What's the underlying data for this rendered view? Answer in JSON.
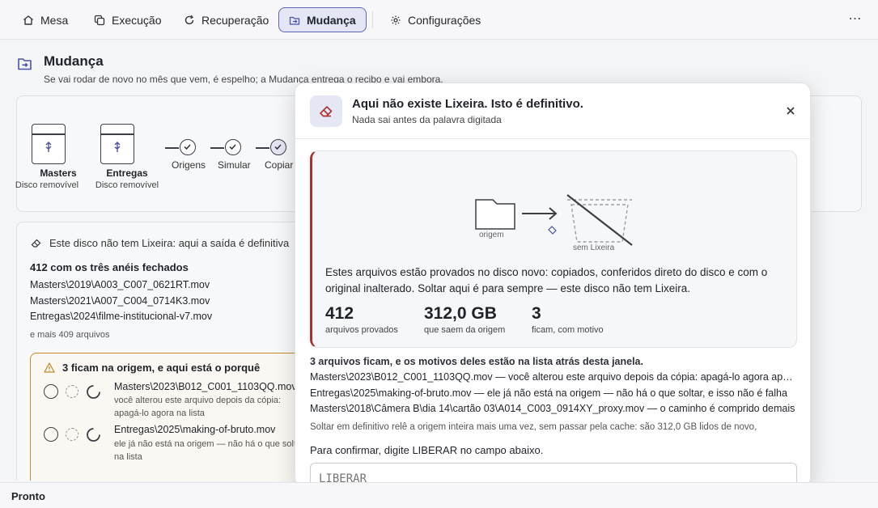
{
  "nav": {
    "tabs": [
      {
        "label": "Mesa",
        "icon": "home-icon"
      },
      {
        "label": "Execução",
        "icon": "copy-icon"
      },
      {
        "label": "Recuperação",
        "icon": "refresh-icon"
      },
      {
        "label": "Mudança",
        "icon": "move-icon",
        "active": true
      },
      {
        "label": "Configurações",
        "icon": "gear-icon"
      }
    ],
    "more_label": "⋯"
  },
  "page": {
    "title": "Mudança",
    "subtitle": "Se vai rodar de novo no mês que vem, é espelho; a Mudança entrega o recibo e vai embora."
  },
  "disks": [
    {
      "name": "Masters",
      "sub": "Disco removível"
    },
    {
      "name": "Entregas",
      "sub": "Disco removível"
    }
  ],
  "steps": [
    "Origens",
    "Simular",
    "Copiar"
  ],
  "trash_card": {
    "header": "Este disco não tem Lixeira: aqui a saída é definitiva",
    "title": "412 com os três anéis fechados",
    "files": [
      "Masters\\2019\\A003_C007_0621RT.mov",
      "Masters\\2021\\A007_C004_0714K3.mov",
      "Entregas\\2024\\filme-institucional-v7.mov"
    ],
    "more": "e mais 409 arquivos",
    "warning": {
      "title": "3 ficam na origem, e aqui está o porquê",
      "items": [
        {
          "name": "Masters\\2023\\B012_C001_1103QQ.mov",
          "reason": "você alterou este arquivo depois da cópia: apagá-lo agora na lista"
        },
        {
          "name": "Entregas\\2025\\making-of-bruto.mov",
          "reason": "ele já não está na origem — não há o que soltar, na lista"
        }
      ]
    }
  },
  "modal": {
    "title": "Aqui não existe Lixeira. Isto é definitivo.",
    "subtitle": "Nada sai antes da palavra digitada",
    "illus_origem": "origem",
    "illus_sem": "sem Lixeira",
    "text": "Estes arquivos estão provados no disco novo: copiados, conferidos direto do disco e com o original inalterado. Soltar aqui é para sempre — este disco não tem Lixeira.",
    "stats": [
      {
        "value": "412",
        "label": "arquivos provados"
      },
      {
        "value": "312,0 GB",
        "label": "que saem da origem"
      },
      {
        "value": "3",
        "label": "ficam, com motivo"
      }
    ],
    "stay_title": "3 arquivos ficam, e os motivos deles estão na lista atrás desta janela.",
    "stay_items": [
      "Masters\\2023\\B012_C001_1103QQ.mov — você alterou este arquivo depois da cópia: apagá-lo agora apagaria a versão nova",
      "Entregas\\2025\\making-of-bruto.mov — ele já não está na origem — não há o que soltar, e isso não é falha",
      "Masters\\2018\\Câmera B\\dia 14\\cartão 03\\A014_C003_0914XY_proxy.mov — o caminho é comprido demais"
    ],
    "note": "Soltar em definitivo relê a origem inteira mais uma vez, sem passar pela cache: são 312,0 GB lidos de novo,",
    "confirm_label": "Para confirmar, digite LIBERAR no campo abaixo.",
    "input_placeholder": "LIBERAR",
    "accent": "#b03030"
  },
  "status": {
    "text": "Pronto"
  },
  "colors": {
    "accent": "#5d64b5",
    "warning": "#c48a2a",
    "danger": "#b03030"
  }
}
